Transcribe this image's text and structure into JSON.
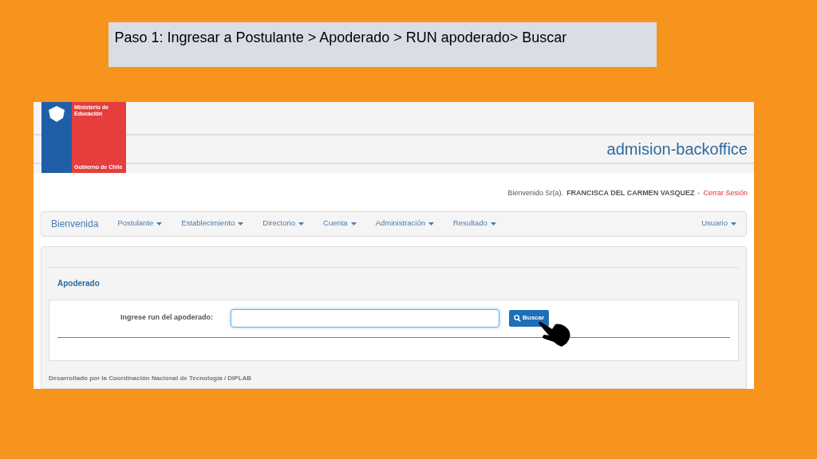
{
  "caption": "Paso 1: Ingresar a Postulante > Apoderado > RUN apoderado> Buscar",
  "logo": {
    "line_1": "Ministerio de",
    "line_2": "Educación",
    "footer": "Gobierno de Chile"
  },
  "app_title": "admision-backoffice",
  "welcome": {
    "prefix": "Bienvenido Sr(a).",
    "user": "FRANCISCA DEL CARMEN VASQUEZ",
    "separator": "-",
    "logout": "Cerrar Sesión"
  },
  "navbar": {
    "brand": "Bienvenida",
    "menus": [
      {
        "label": "Postulante"
      },
      {
        "label": "Establecimiento"
      },
      {
        "label": "Directorio"
      },
      {
        "label": "Cuenta"
      },
      {
        "label": "Administración"
      },
      {
        "label": "Resultado"
      }
    ],
    "user_menu": "Usuario"
  },
  "panel": {
    "title": "Apoderado",
    "field_label": "Ingrese run del apoderado:",
    "button": "Buscar"
  },
  "footer": "Desarrollado por la Coordinación Nacional de Tecnología / DIPLAB"
}
